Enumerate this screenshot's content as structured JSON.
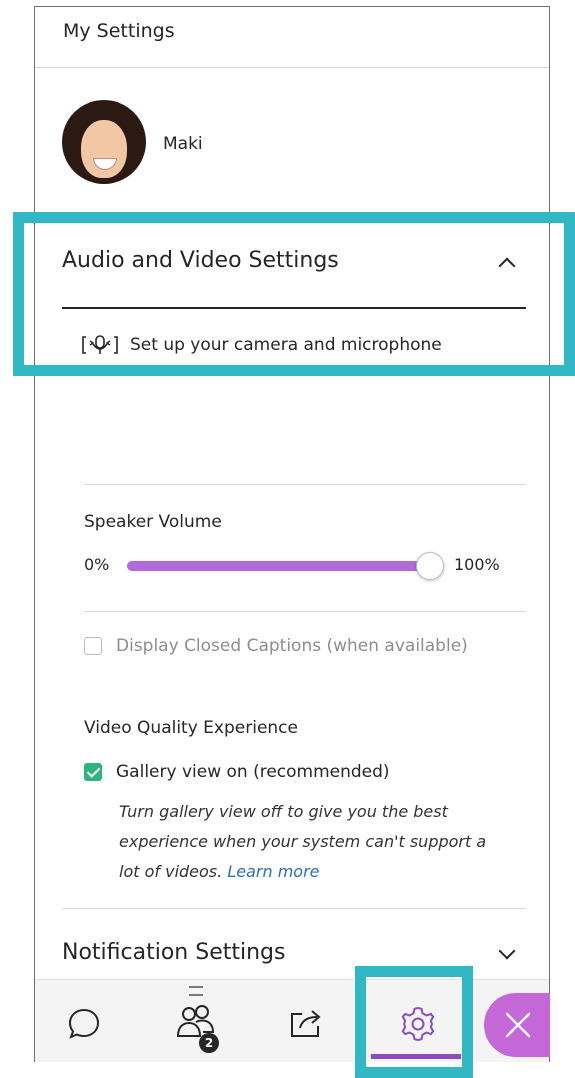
{
  "header": {
    "title": "My Settings"
  },
  "user": {
    "name": "Maki"
  },
  "audio_video": {
    "title": "Audio and Video Settings",
    "setup_label": "Set up your camera and microphone"
  },
  "speaker": {
    "label": "Speaker Volume",
    "min_label": "0%",
    "max_label": "100%",
    "level_fraction": 1.0
  },
  "captions": {
    "label": "Display Closed Captions (when available)",
    "checked": false
  },
  "video_quality": {
    "label": "Video Quality Experience",
    "gallery_label": "Gallery view on (recommended)",
    "gallery_checked": true,
    "note": "Turn gallery view off to give you the best experience when your system can't support a lot of videos.",
    "learn_more": "Learn more"
  },
  "notifications": {
    "title": "Notification Settings"
  },
  "nav": {
    "participants_badge": "2",
    "icons": [
      "chat-icon",
      "participants-icon",
      "share-content-icon",
      "settings-icon",
      "close-icon"
    ]
  },
  "colors": {
    "highlight": "#32b8c4",
    "accent_purple": "#b26ad8",
    "check_green": "#2fb47e",
    "link_blue": "#2f6fb6"
  }
}
